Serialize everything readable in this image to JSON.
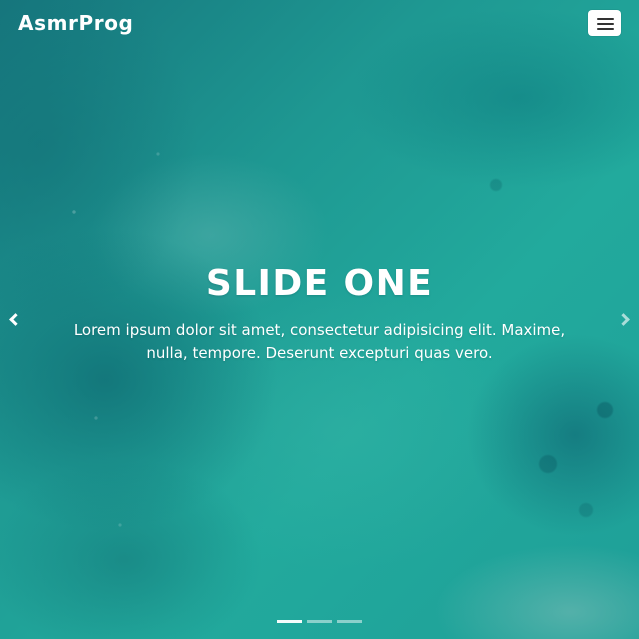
{
  "navbar": {
    "brand": "AsmrProg",
    "menu_icon": "hamburger-menu-icon"
  },
  "hero": {
    "title": "SLIDE ONE",
    "text": "Lorem ipsum dolor sit amet, consectetur adipisicing elit. Maxime, nulla, tempore. Deserunt excepturi quas vero.",
    "background_color": "#1e9f98"
  },
  "carousel": {
    "previous_icon": "chevron-left-icon",
    "next_icon": "chevron-right-icon",
    "slides_count": 3,
    "active_slide": 1
  }
}
